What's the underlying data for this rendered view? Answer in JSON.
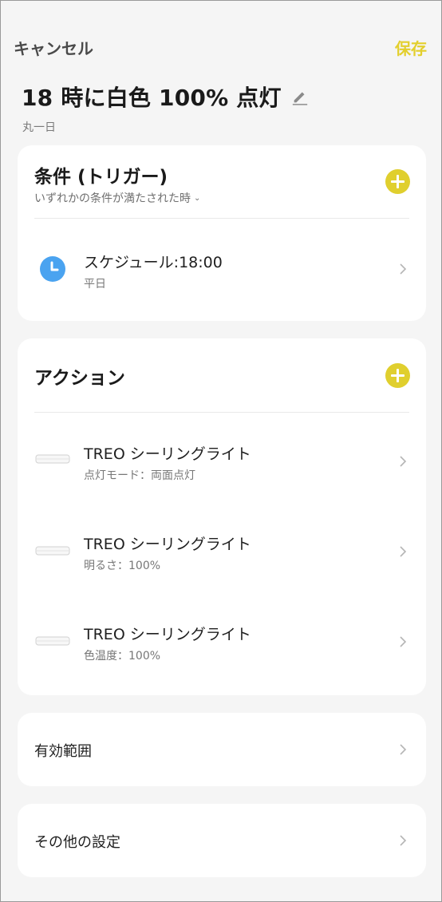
{
  "header": {
    "cancel_label": "キャンセル",
    "save_label": "保存"
  },
  "scene": {
    "title": "18 時に白色 100% 点灯",
    "subtitle": "丸一日"
  },
  "conditions": {
    "title": "条件 (トリガー)",
    "mode": "いずれかの条件が満たされた時",
    "items": [
      {
        "title": "スケジュール:18:00",
        "subtitle": "平日",
        "icon": "clock-icon"
      }
    ]
  },
  "actions": {
    "title": "アクション",
    "items": [
      {
        "title": "TREO シーリングライト",
        "subtitle": "点灯モード：両面点灯",
        "icon": "ceiling-light-icon"
      },
      {
        "title": "TREO シーリングライト",
        "subtitle": "明るさ：100%",
        "icon": "ceiling-light-icon"
      },
      {
        "title": "TREO シーリングライト",
        "subtitle": "色温度：100%",
        "icon": "ceiling-light-icon"
      }
    ]
  },
  "valid_range": {
    "label": "有効範囲"
  },
  "other_settings": {
    "label": "その他の設定"
  },
  "colors": {
    "accent": "#e0cf2e",
    "clock_blue": "#4aa3f0",
    "background": "#f5f5f5",
    "card": "#ffffff"
  }
}
